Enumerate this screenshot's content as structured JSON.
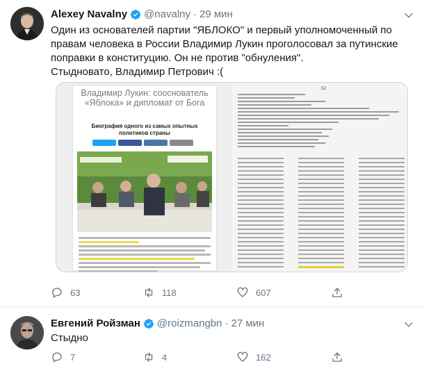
{
  "tweet1": {
    "author_name": "Alexey Navalny",
    "handle": "@navalny",
    "separator": "·",
    "time": "29 мин",
    "text": "Один из основателей партии \"ЯБЛОКО\" и первый уполномоченный по правам человека в России Владимир Лукин проголосовал за путинские поправки в конституцию. Он не против \"обнуления\".\nСтыдновато, Владимир Петрович :(",
    "media": {
      "left": {
        "title": "Владимир Лукин: сооснователь «Яблока» и дипломат от Бога",
        "subtitle": "Биография одного из самых опытных политиков страны"
      },
      "right": {
        "page_number": "52"
      }
    },
    "reply_count": "63",
    "retweet_count": "118",
    "like_count": "607"
  },
  "tweet2": {
    "author_name": "Евгений Ройзман",
    "handle": "@roizmangbn",
    "separator": "·",
    "time": "27 мин",
    "text": "Стыдно",
    "reply_count": "7",
    "retweet_count": "4",
    "like_count": "162"
  },
  "colors": {
    "verified_blue": "#1da1f2",
    "secondary_text": "#657786",
    "highlight_yellow": "#f0d94a"
  },
  "icons": [
    "verified-badge-icon",
    "chevron-down-icon",
    "reply-icon",
    "retweet-icon",
    "like-icon",
    "share-icon"
  ]
}
